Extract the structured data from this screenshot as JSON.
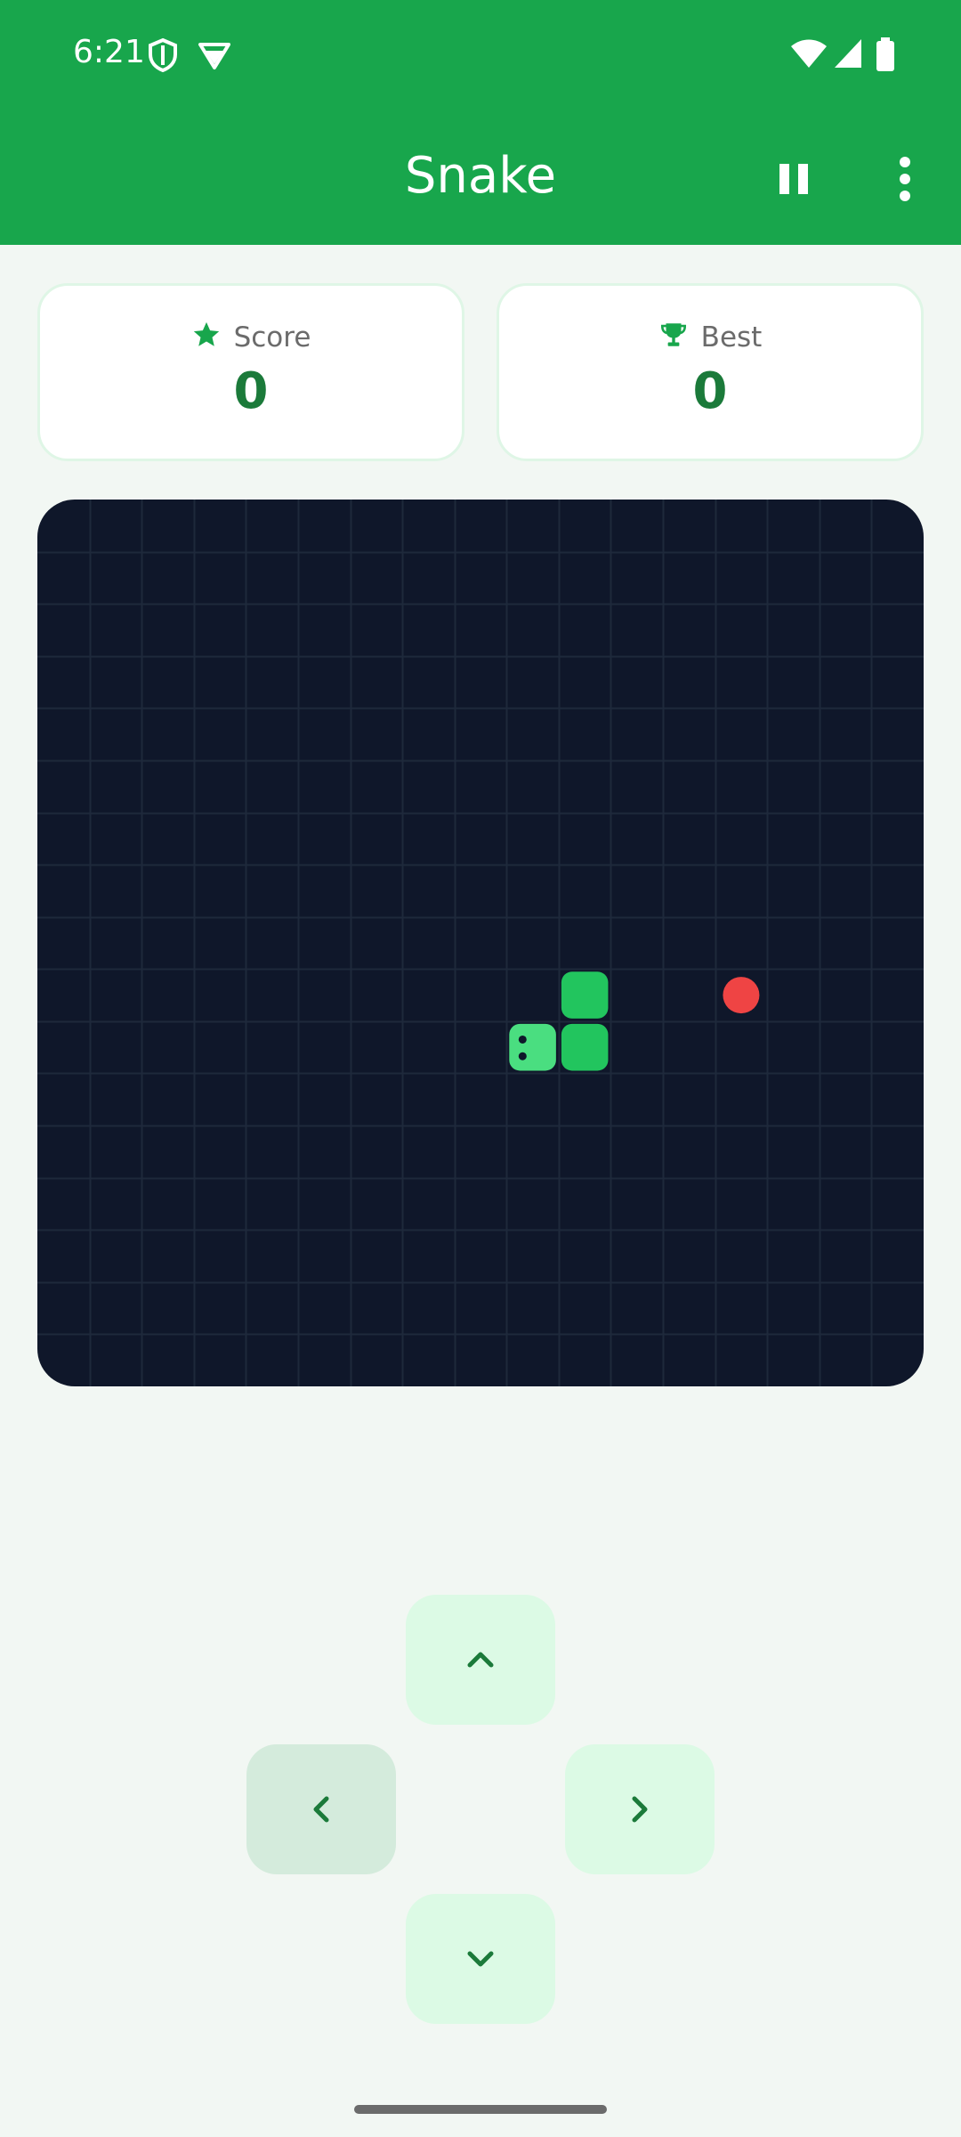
{
  "status_bar": {
    "time": "6:21",
    "icons": [
      "shield-icon",
      "vpn-icon",
      "wifi-icon",
      "signal-icon",
      "battery-icon"
    ]
  },
  "app_bar": {
    "title": "Snake",
    "pause_icon": "pause-icon",
    "menu_icon": "more-vert-icon",
    "color": "#18a64c"
  },
  "score_card": {
    "label": "Score",
    "value": "0",
    "icon": "star-icon"
  },
  "best_card": {
    "label": "Best",
    "value": "0",
    "icon": "trophy-icon"
  },
  "board": {
    "columns": 17,
    "rows": 17,
    "background": "#0f172a",
    "grid_color": "#1e293b",
    "snake": [
      [
        9,
        10
      ],
      [
        10,
        10
      ],
      [
        10,
        9
      ]
    ],
    "food": [
      13,
      9
    ],
    "snake_head_color": "#4ade80",
    "snake_body_color": "#22c55e",
    "food_color": "#ef4444"
  },
  "controls": {
    "up_icon": "chevron-up-icon",
    "left_icon": "chevron-left-icon",
    "right_icon": "chevron-right-icon",
    "down_icon": "chevron-down-icon",
    "active": "left"
  }
}
